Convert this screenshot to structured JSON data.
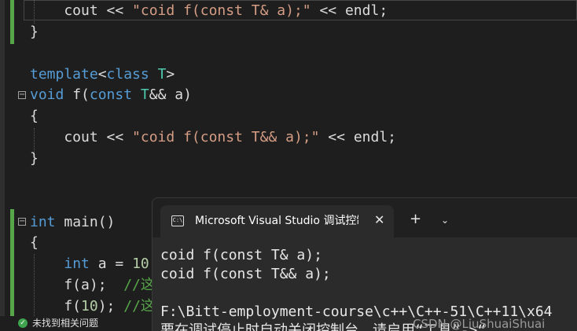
{
  "editor": {
    "lines": [
      {
        "tokens": [
          {
            "t": "    cout << ",
            "c": "plain"
          },
          {
            "t": "\"coid f(const T& a);\"",
            "c": "str"
          },
          {
            "t": " << endl;",
            "c": "plain"
          }
        ]
      },
      {
        "tokens": [
          {
            "t": "}",
            "c": "brace"
          }
        ]
      },
      {
        "tokens": []
      },
      {
        "tokens": [
          {
            "t": "template",
            "c": "kw"
          },
          {
            "t": "<",
            "c": "plain"
          },
          {
            "t": "class",
            "c": "kw"
          },
          {
            "t": " ",
            "c": "plain"
          },
          {
            "t": "T",
            "c": "ty"
          },
          {
            "t": ">",
            "c": "plain"
          }
        ]
      },
      {
        "tokens": [
          {
            "t": "void",
            "c": "kw"
          },
          {
            "t": " f(",
            "c": "plain"
          },
          {
            "t": "const",
            "c": "kw"
          },
          {
            "t": " ",
            "c": "plain"
          },
          {
            "t": "T",
            "c": "ty"
          },
          {
            "t": "&& a)",
            "c": "plain"
          }
        ]
      },
      {
        "tokens": [
          {
            "t": "{",
            "c": "brace"
          }
        ]
      },
      {
        "tokens": [
          {
            "t": "    cout << ",
            "c": "plain"
          },
          {
            "t": "\"coid f(const T&& a);\"",
            "c": "str"
          },
          {
            "t": " << endl;",
            "c": "plain"
          }
        ]
      },
      {
        "tokens": [
          {
            "t": "}",
            "c": "brace"
          }
        ]
      },
      {
        "tokens": []
      },
      {
        "tokens": []
      },
      {
        "tokens": [
          {
            "t": "int",
            "c": "kw"
          },
          {
            "t": " main()",
            "c": "plain"
          }
        ]
      },
      {
        "tokens": [
          {
            "t": "{",
            "c": "brace"
          }
        ]
      },
      {
        "tokens": [
          {
            "t": "    ",
            "c": "plain"
          },
          {
            "t": "int",
            "c": "kw"
          },
          {
            "t": " a = ",
            "c": "plain"
          },
          {
            "t": "10",
            "c": "num"
          }
        ]
      },
      {
        "tokens": [
          {
            "t": "    f(a);  ",
            "c": "plain"
          },
          {
            "t": "//这",
            "c": "cm"
          }
        ]
      },
      {
        "tokens": [
          {
            "t": "    f(",
            "c": "plain"
          },
          {
            "t": "10",
            "c": "num"
          },
          {
            "t": "); ",
            "c": "plain"
          },
          {
            "t": "//这",
            "c": "cm"
          }
        ]
      }
    ]
  },
  "status": {
    "icon": "check-circle-icon",
    "text": "未找到相关问题"
  },
  "terminal": {
    "tab_icon": "C:\\",
    "tab_title": "Microsoft Visual Studio 调试控制台",
    "close_symbol": "✕",
    "new_tab_symbol": "+",
    "dropdown_symbol": "⌄",
    "lines": [
      "coid f(const T& a);",
      "coid f(const T&& a);",
      "",
      "F:\\Bitt-employment-course\\c++\\C++-51\\C++11\\x64",
      "要在调试停止时自动关闭控制台，请启用“工具”->“"
    ]
  },
  "watermark": "CSDN @LiuShuaiShuai"
}
